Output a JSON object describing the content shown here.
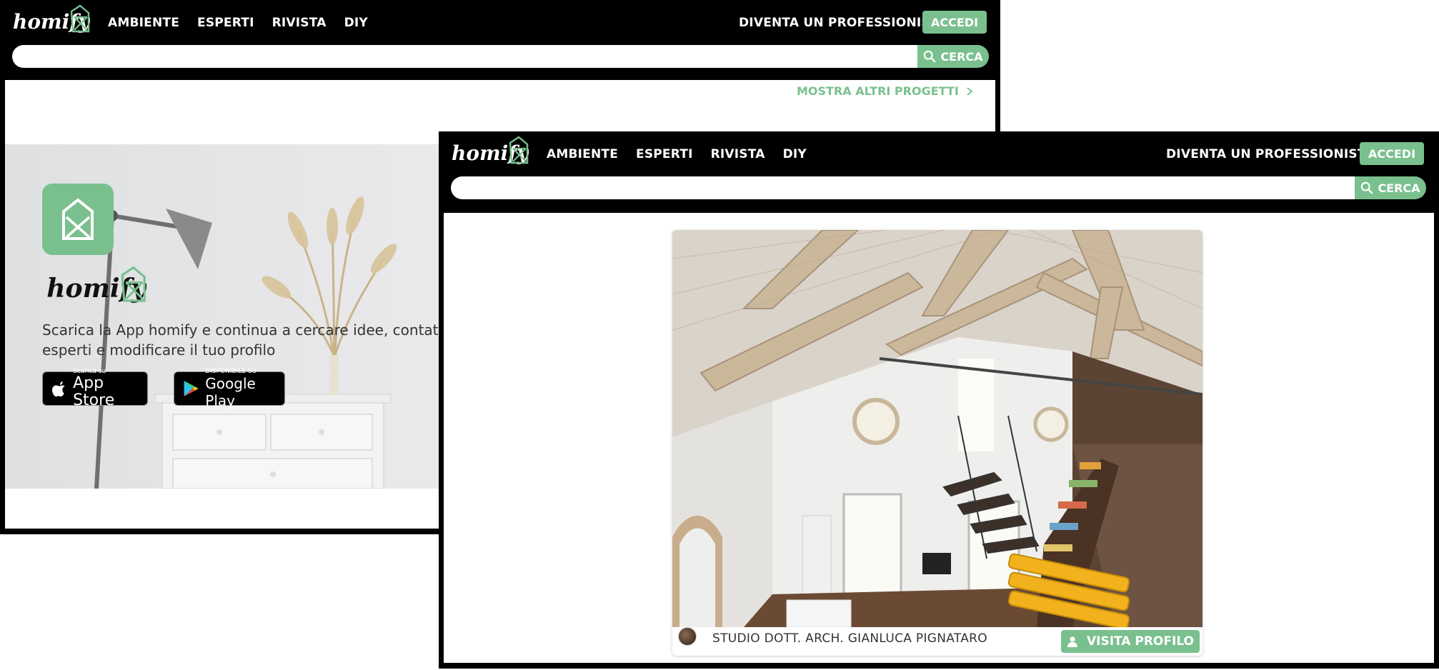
{
  "windows": [
    {
      "header": {
        "nav": [
          "AMBIENTE",
          "ESPERTI",
          "RIVISTA",
          "DIY"
        ],
        "pro_link": "DIVENTA UN PROFESSIONISTA",
        "login": "ACCEDI",
        "search_placeholder": "",
        "search_button": "CERCA"
      },
      "more_projects": "MOSTRA ALTRI PROGETTI",
      "app_banner": {
        "text": "Scarica la App homify e continua a cercare idee, contattare esperti e modificare il tuo profilo",
        "app_store": {
          "small": "Scarica su",
          "big": "App Store"
        },
        "google_play": {
          "small": "DISPONIBILE SU",
          "big": "Google Play"
        }
      }
    },
    {
      "header": {
        "nav": [
          "AMBIENTE",
          "ESPERTI",
          "RIVISTA",
          "DIY"
        ],
        "pro_link": "DIVENTA UN PROFESSIONISTA",
        "login": "ACCEDI",
        "search_placeholder": "",
        "search_button": "CERCA"
      },
      "project_card": {
        "studio_name": "STUDIO DOTT. ARCH. GIANLUCA PIGNATARO",
        "visit_button": "VISITA PROFILO"
      }
    }
  ],
  "brand": {
    "accent": "#7ac08f",
    "header_bg": "#000000"
  }
}
